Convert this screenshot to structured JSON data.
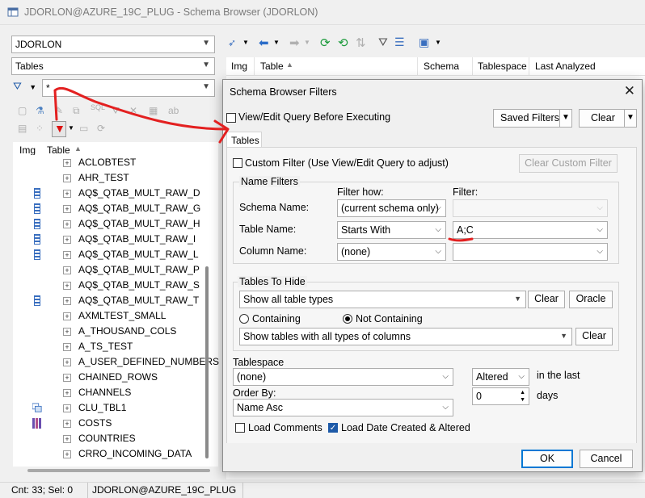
{
  "window": {
    "title": "JDORLON@AZURE_19C_PLUG - Schema Browser (JDORLON)"
  },
  "left_panel": {
    "schema_value": "JDORLON",
    "object_type_value": "Tables",
    "filter_value": "*",
    "grid_headers": {
      "img": "Img",
      "table": "Table"
    },
    "tables": [
      {
        "name": "ACLOBTEST",
        "icon": ""
      },
      {
        "name": "AHR_TEST",
        "icon": ""
      },
      {
        "name": "AQ$_QTAB_MULT_RAW_D",
        "icon": "queue-table-icon"
      },
      {
        "name": "AQ$_QTAB_MULT_RAW_G",
        "icon": "queue-table-icon"
      },
      {
        "name": "AQ$_QTAB_MULT_RAW_H",
        "icon": "queue-table-icon"
      },
      {
        "name": "AQ$_QTAB_MULT_RAW_I",
        "icon": "queue-table-icon"
      },
      {
        "name": "AQ$_QTAB_MULT_RAW_L",
        "icon": "queue-table-icon"
      },
      {
        "name": "AQ$_QTAB_MULT_RAW_P",
        "icon": ""
      },
      {
        "name": "AQ$_QTAB_MULT_RAW_S",
        "icon": ""
      },
      {
        "name": "AQ$_QTAB_MULT_RAW_T",
        "icon": "queue-table-icon"
      },
      {
        "name": "AXMLTEST_SMALL",
        "icon": ""
      },
      {
        "name": "A_THOUSAND_COLS",
        "icon": ""
      },
      {
        "name": "A_TS_TEST",
        "icon": ""
      },
      {
        "name": "A_USER_DEFINED_NUMBERS",
        "icon": ""
      },
      {
        "name": "CHAINED_ROWS",
        "icon": ""
      },
      {
        "name": "CHANNELS",
        "icon": ""
      },
      {
        "name": "CLU_TBL1",
        "icon": "cluster-table-icon"
      },
      {
        "name": "COSTS",
        "icon": "partitioned-table-icon"
      },
      {
        "name": "COUNTRIES",
        "icon": ""
      },
      {
        "name": "CRRO_INCOMING_DATA",
        "icon": ""
      }
    ]
  },
  "right_grid": {
    "headers": {
      "img": "Img",
      "table": "Table",
      "schema": "Schema",
      "tablespace": "Tablespace",
      "last_analyzed": "Last Analyzed"
    }
  },
  "statusbar": {
    "count": "Cnt: 33; Sel: 0",
    "connection": "JDORLON@AZURE_19C_PLUG"
  },
  "dialog": {
    "title": "Schema Browser Filters",
    "view_edit_query_label": "View/Edit Query Before Executing",
    "saved_filters_label": "Saved Filters",
    "clear_label": "Clear",
    "tab_label": "Tables",
    "custom_filter_label": "Custom Filter (Use View/Edit Query to adjust)",
    "clear_custom_filter_label": "Clear Custom Filter",
    "name_filters": {
      "title": "Name Filters",
      "filter_how_header": "Filter how:",
      "filter_header": "Filter:",
      "schema_label": "Schema Name:",
      "schema_how": "(current schema only)",
      "schema_filter": "",
      "table_label": "Table Name:",
      "table_how": "Starts With",
      "table_filter": "A;C",
      "column_label": "Column Name:",
      "column_how": "(none)",
      "column_filter": ""
    },
    "tables_to_hide": {
      "title": "Tables To Hide",
      "table_types_value": "Show all table types",
      "clear_label": "Clear",
      "oracle_label": "Oracle",
      "containing_label": "Containing",
      "not_containing_label": "Not Containing",
      "selected_mode": "not_containing",
      "column_types_value": "Show tables with all types of columns",
      "clear2_label": "Clear"
    },
    "tablespace_label": "Tablespace",
    "tablespace_value": "(none)",
    "order_by_label": "Order By:",
    "order_by_value": "Name Asc",
    "altered_value": "Altered",
    "in_the_last_label": "in the last",
    "days_value": "0",
    "days_label": "days",
    "load_comments_label": "Load Comments",
    "load_comments_checked": false,
    "load_dates_label": "Load Date Created & Altered",
    "load_dates_checked": true,
    "ok_label": "OK",
    "cancel_label": "Cancel"
  }
}
